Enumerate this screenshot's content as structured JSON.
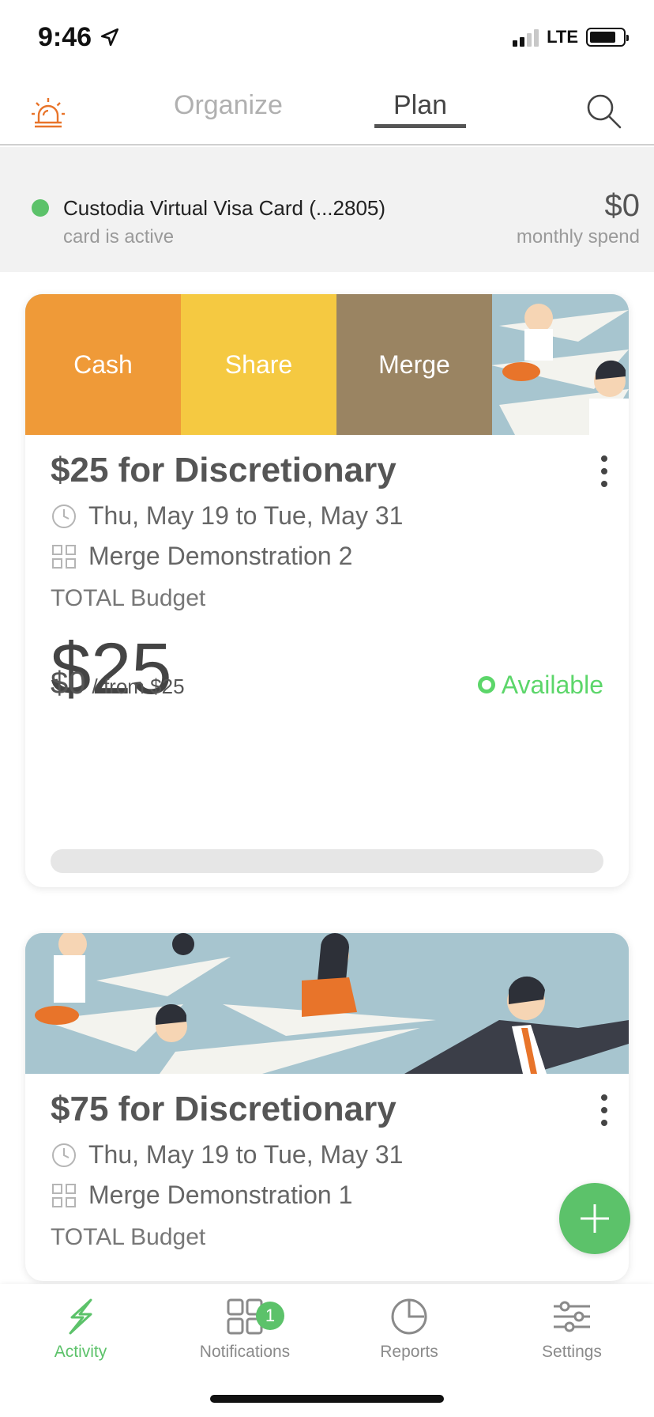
{
  "status_bar": {
    "time": "9:46",
    "network": "LTE"
  },
  "tabs": {
    "organize": "Organize",
    "plan": "Plan"
  },
  "card_info": {
    "name": "Custodia Virtual Visa Card (...2805)",
    "status": "card is active",
    "spend_amount": "$0",
    "spend_label": "monthly spend",
    "status_color": "#5cc26a"
  },
  "actions": {
    "cash": "Cash",
    "share": "Share",
    "merge": "Merge"
  },
  "budgets": [
    {
      "title": "$25 for Discretionary",
      "dates": "Thu, May 19 to Tue, May 31",
      "group": "Merge Demonstration 2",
      "total_label": "TOTAL Budget",
      "amount": "$25",
      "spent": "$0",
      "from": "/ from $25",
      "status": "Available",
      "spent_fraction": 0
    },
    {
      "title": "$75 for Discretionary",
      "dates": "Thu, May 19 to Tue, May 31",
      "group": "Merge Demonstration 1",
      "total_label": "TOTAL Budget"
    }
  ],
  "bottom_nav": {
    "activity": "Activity",
    "notifications": "Notifications",
    "notifications_badge": "1",
    "reports": "Reports",
    "settings": "Settings"
  },
  "colors": {
    "accent": "#5cc26a",
    "available": "#5cd66a",
    "cash": "#ef9a38",
    "share": "#f5c941",
    "merge": "#9a8462",
    "alarm": "#e8742a"
  },
  "icons": [
    "alarm-icon",
    "search-icon",
    "clock-icon",
    "grid-icon",
    "kebab-icon",
    "plus-icon",
    "activity-icon",
    "notifications-icon",
    "reports-icon",
    "settings-icon"
  ]
}
